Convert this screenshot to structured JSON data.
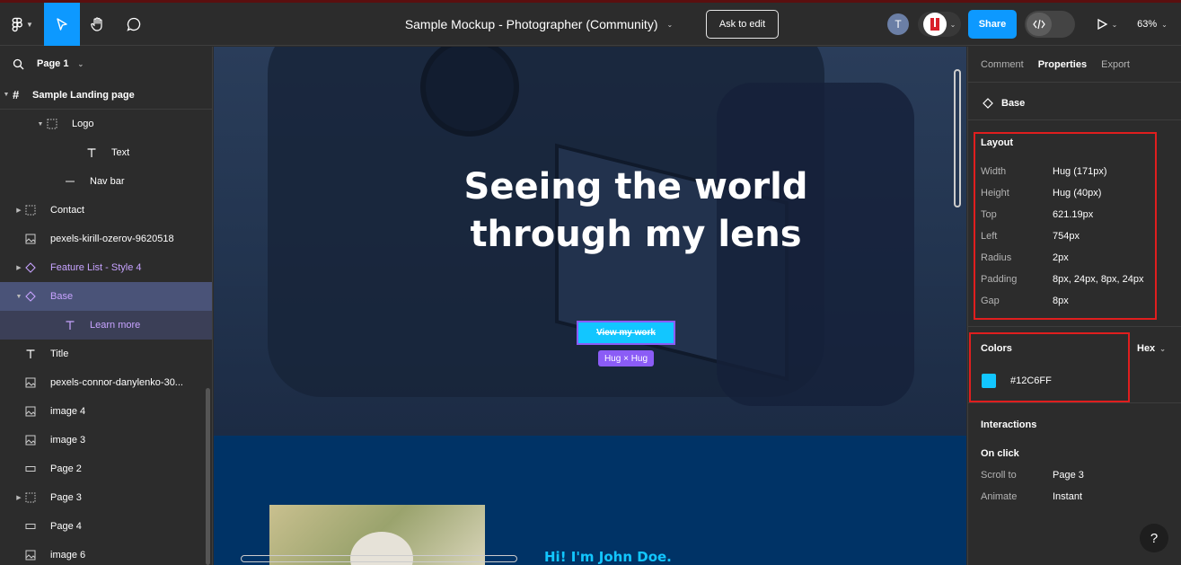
{
  "topbar": {
    "file_title": "Sample Mockup - Photographer (Community)",
    "ask_edit_label": "Ask to edit",
    "avatar_initial": "T",
    "share_label": "Share",
    "zoom": "63%"
  },
  "left_panel": {
    "page_label": "Page 1",
    "root_layer": "Sample Landing page",
    "layers": [
      {
        "label": "Logo",
        "icon": "frame-icon",
        "indent": 40,
        "caret": "▼"
      },
      {
        "label": "Text",
        "icon": "text-icon",
        "indent": 84,
        "caret": ""
      },
      {
        "label": "Nav bar",
        "icon": "line-icon",
        "indent": 60,
        "caret": ""
      },
      {
        "label": "Contact",
        "icon": "frame-icon",
        "indent": 16,
        "caret": "▶"
      },
      {
        "label": "pexels-kirill-ozerov-9620518",
        "icon": "image-icon",
        "indent": 16,
        "caret": ""
      },
      {
        "label": "Feature List - Style 4",
        "icon": "instance-icon",
        "indent": 16,
        "caret": "▶"
      },
      {
        "label": "Base",
        "icon": "instance-icon",
        "indent": 16,
        "caret": "▼"
      },
      {
        "label": "Learn more",
        "icon": "text-icon",
        "indent": 60,
        "caret": ""
      },
      {
        "label": "Title",
        "icon": "text-icon",
        "indent": 16,
        "caret": ""
      },
      {
        "label": "pexels-connor-danylenko-30...",
        "icon": "image-icon",
        "indent": 16,
        "caret": ""
      },
      {
        "label": "image 4",
        "icon": "image-icon",
        "indent": 16,
        "caret": ""
      },
      {
        "label": "image 3",
        "icon": "image-icon",
        "indent": 16,
        "caret": ""
      },
      {
        "label": "Page 2",
        "icon": "rect-icon",
        "indent": 16,
        "caret": ""
      },
      {
        "label": "Page 3",
        "icon": "frame-icon",
        "indent": 16,
        "caret": "▶"
      },
      {
        "label": "Page 4",
        "icon": "rect-icon",
        "indent": 16,
        "caret": ""
      },
      {
        "label": "image 6",
        "icon": "image-icon",
        "indent": 16,
        "caret": ""
      }
    ]
  },
  "canvas": {
    "hero_line1": "Seeing the world",
    "hero_line2": "through my lens",
    "cta_label": "View my work",
    "hug_badge": "Hug × Hug",
    "about_heading": "Hi! I'm John Doe."
  },
  "right_panel": {
    "tabs": [
      "Comment",
      "Properties",
      "Export"
    ],
    "selected_name": "Base",
    "layout": {
      "title": "Layout",
      "rows": [
        {
          "label": "Width",
          "value": "Hug (171px)"
        },
        {
          "label": "Height",
          "value": "Hug (40px)"
        },
        {
          "label": "Top",
          "value": "621.19px"
        },
        {
          "label": "Left",
          "value": "754px"
        },
        {
          "label": "Radius",
          "value": "2px"
        },
        {
          "label": "Padding",
          "value": "8px, 24px, 8px, 24px"
        },
        {
          "label": "Gap",
          "value": "8px"
        }
      ]
    },
    "colors": {
      "title": "Colors",
      "format": "Hex",
      "swatch_value": "#12C6FF"
    },
    "interactions": {
      "title": "Interactions",
      "trigger": "On click",
      "rows": [
        {
          "label": "Scroll to",
          "value": "Page 3"
        },
        {
          "label": "Animate",
          "value": "Instant"
        }
      ]
    },
    "help": "?"
  },
  "colors": {
    "accent": "#0d99ff",
    "brand_cyan": "#12c6ff",
    "selection_purple": "#8b5cf6",
    "highlight_red": "#e01e1e"
  }
}
